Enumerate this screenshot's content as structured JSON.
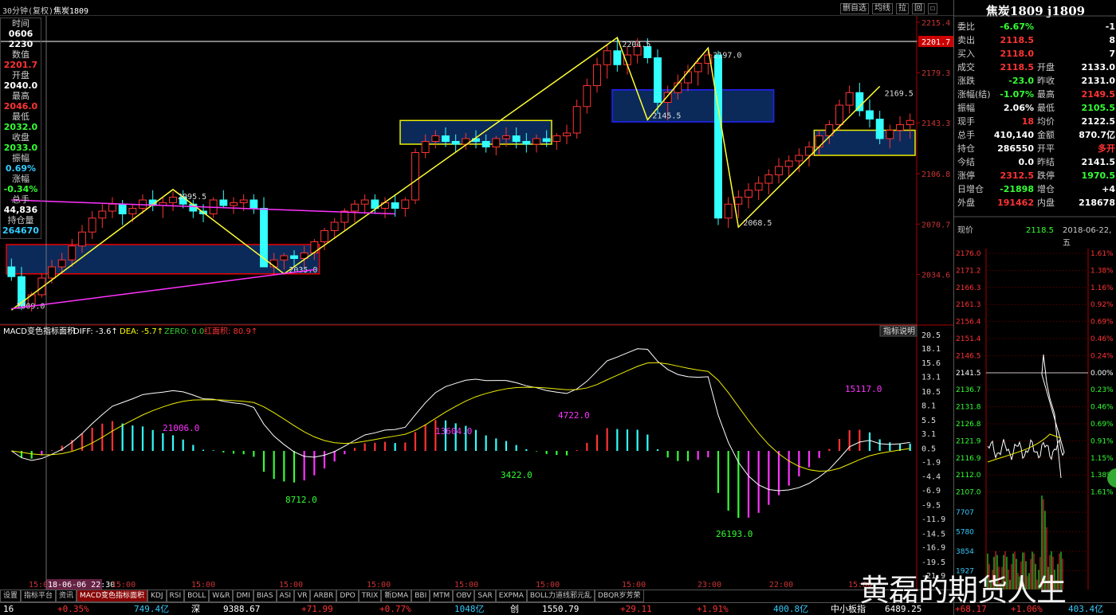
{
  "window": {
    "period": "30分钟(复权)",
    "symbol": "焦炭1809",
    "tools": [
      "删自选",
      "均线",
      "拉",
      "回",
      "☐"
    ]
  },
  "left_panel": [
    {
      "label": "时间",
      "value": "0606",
      "color": "#fff"
    },
    {
      "label": "",
      "value": "2230",
      "color": "#fff"
    },
    {
      "label": "数值",
      "value": "2201.7",
      "color": "#ff3333"
    },
    {
      "label": "开盘",
      "value": "2040.0",
      "color": "#fff"
    },
    {
      "label": "最高",
      "value": "2046.0",
      "color": "#ff3333"
    },
    {
      "label": "最低",
      "value": "2032.0",
      "color": "#33ff33"
    },
    {
      "label": "收盘",
      "value": "2033.0",
      "color": "#33ff33"
    },
    {
      "label": "振幅",
      "value": "0.69%",
      "color": "#33ccff"
    },
    {
      "label": "涨幅",
      "value": "-0.34%",
      "color": "#33ff33"
    },
    {
      "label": "总手",
      "value": "44,836",
      "color": "#fff"
    },
    {
      "label": "持仓量",
      "value": "264670",
      "color": "#33ccff"
    }
  ],
  "chart_data": {
    "type": "candlestick",
    "price_axis": [
      "2215.4",
      "2201.7",
      "2179.3",
      "2143.3",
      "2106.8",
      "2070.7",
      "2034.6"
    ],
    "current_price_label": "2201.7",
    "ylim": [
      2000,
      2220
    ],
    "candles": [
      [
        2040,
        2046,
        2030,
        2033
      ],
      [
        2033,
        2040,
        2009,
        2012
      ],
      [
        2012,
        2022,
        2008,
        2020
      ],
      [
        2020,
        2035,
        2018,
        2032
      ],
      [
        2032,
        2045,
        2028,
        2040
      ],
      [
        2040,
        2050,
        2035,
        2045
      ],
      [
        2045,
        2060,
        2040,
        2055
      ],
      [
        2055,
        2070,
        2050,
        2065
      ],
      [
        2065,
        2080,
        2060,
        2075
      ],
      [
        2075,
        2085,
        2068,
        2080
      ],
      [
        2080,
        2090,
        2075,
        2085
      ],
      [
        2085,
        2088,
        2070,
        2078
      ],
      [
        2078,
        2085,
        2072,
        2082
      ],
      [
        2082,
        2092,
        2078,
        2088
      ],
      [
        2088,
        2095,
        2080,
        2084
      ],
      [
        2084,
        2090,
        2075,
        2086
      ],
      [
        2086,
        2094,
        2080,
        2090
      ],
      [
        2090,
        2095,
        2082,
        2085
      ],
      [
        2085,
        2088,
        2075,
        2080
      ],
      [
        2080,
        2085,
        2072,
        2078
      ],
      [
        2078,
        2090,
        2075,
        2088
      ],
      [
        2088,
        2095,
        2082,
        2084
      ],
      [
        2084,
        2090,
        2078,
        2086
      ],
      [
        2086,
        2092,
        2080,
        2088
      ],
      [
        2088,
        2092,
        2078,
        2082
      ],
      [
        2082,
        2090,
        2040,
        2040
      ],
      [
        2040,
        2050,
        2035,
        2045
      ],
      [
        2045,
        2050,
        2038,
        2048
      ],
      [
        2048,
        2052,
        2040,
        2046
      ],
      [
        2046,
        2055,
        2040,
        2050
      ],
      [
        2050,
        2060,
        2045,
        2058
      ],
      [
        2058,
        2068,
        2052,
        2066
      ],
      [
        2066,
        2075,
        2060,
        2072
      ],
      [
        2072,
        2082,
        2066,
        2080
      ],
      [
        2080,
        2088,
        2072,
        2085
      ],
      [
        2085,
        2092,
        2078,
        2088
      ],
      [
        2088,
        2092,
        2078,
        2082
      ],
      [
        2082,
        2090,
        2075,
        2086
      ],
      [
        2086,
        2092,
        2076,
        2082
      ],
      [
        2082,
        2090,
        2076,
        2088
      ],
      [
        2088,
        2125,
        2085,
        2122
      ],
      [
        2122,
        2135,
        2118,
        2130
      ],
      [
        2130,
        2138,
        2125,
        2134
      ],
      [
        2134,
        2140,
        2126,
        2130
      ],
      [
        2130,
        2135,
        2122,
        2128
      ],
      [
        2128,
        2136,
        2124,
        2132
      ],
      [
        2132,
        2138,
        2125,
        2130
      ],
      [
        2130,
        2135,
        2122,
        2126
      ],
      [
        2126,
        2134,
        2120,
        2132
      ],
      [
        2132,
        2140,
        2126,
        2134
      ],
      [
        2134,
        2140,
        2125,
        2130
      ],
      [
        2130,
        2136,
        2122,
        2128
      ],
      [
        2128,
        2135,
        2122,
        2132
      ],
      [
        2132,
        2138,
        2126,
        2130
      ],
      [
        2130,
        2136,
        2124,
        2134
      ],
      [
        2134,
        2142,
        2128,
        2136
      ],
      [
        2136,
        2160,
        2132,
        2155
      ],
      [
        2155,
        2175,
        2150,
        2170
      ],
      [
        2170,
        2190,
        2165,
        2185
      ],
      [
        2185,
        2200,
        2175,
        2195
      ],
      [
        2195,
        2205,
        2180,
        2185
      ],
      [
        2185,
        2198,
        2178,
        2192
      ],
      [
        2192,
        2204,
        2186,
        2198
      ],
      [
        2198,
        2204,
        2186,
        2190
      ],
      [
        2190,
        2196,
        2150,
        2158
      ],
      [
        2158,
        2170,
        2145,
        2165
      ],
      [
        2165,
        2178,
        2160,
        2172
      ],
      [
        2172,
        2185,
        2166,
        2180
      ],
      [
        2180,
        2190,
        2170,
        2186
      ],
      [
        2186,
        2197,
        2178,
        2192
      ],
      [
        2192,
        2195,
        2070,
        2075
      ],
      [
        2075,
        2090,
        2068,
        2085
      ],
      [
        2085,
        2095,
        2075,
        2090
      ],
      [
        2090,
        2100,
        2082,
        2095
      ],
      [
        2095,
        2105,
        2088,
        2100
      ],
      [
        2100,
        2110,
        2092,
        2106
      ],
      [
        2106,
        2118,
        2100,
        2112
      ],
      [
        2112,
        2120,
        2104,
        2116
      ],
      [
        2116,
        2125,
        2108,
        2120
      ],
      [
        2120,
        2130,
        2112,
        2126
      ],
      [
        2126,
        2138,
        2120,
        2134
      ],
      [
        2134,
        2145,
        2128,
        2142
      ],
      [
        2142,
        2160,
        2138,
        2156
      ],
      [
        2156,
        2170,
        2150,
        2165
      ],
      [
        2165,
        2172,
        2148,
        2152
      ],
      [
        2152,
        2160,
        2140,
        2146
      ],
      [
        2146,
        2152,
        2128,
        2132
      ],
      [
        2132,
        2142,
        2125,
        2138
      ],
      [
        2138,
        2148,
        2130,
        2142
      ],
      [
        2142,
        2150,
        2132,
        2145
      ]
    ],
    "annotations": [
      "2009.0",
      "2095.5",
      "2035.0",
      "2204.5",
      "2145.5",
      "2197.0",
      "2068.5",
      "2169.5"
    ],
    "macd": {
      "title": "MACD变色指标面积",
      "diff": "DIFF: -3.6↑",
      "dea": "DEA: -5.7↑",
      "zero": "ZERO: 0.0",
      "red_area": "红面积: 80.9↑",
      "axis": [
        "20.5",
        "18.1",
        "15.6",
        "13.1",
        "10.5",
        "8.1",
        "5.5",
        "3.1",
        "0.5",
        "-1.9",
        "-4.4",
        "-6.9",
        "-9.5",
        "-11.9",
        "-14.5",
        "-16.9",
        "-19.5",
        "-21.9"
      ],
      "area_labels": [
        "21006.0",
        "8712.0",
        "13604.0",
        "3422.0",
        "4722.0",
        "26193.0",
        "15117.0"
      ],
      "help": "指标说明"
    },
    "time_axis": [
      "15:00",
      "18-06-06 22:30",
      "15:00",
      "15:00",
      "15:00",
      "15:00",
      "15:00",
      "15:00",
      "15:00",
      "23:00",
      "22:00",
      "15:00"
    ]
  },
  "right_panel": {
    "title": "焦炭1809 j1809",
    "rows": [
      {
        "a": "委比",
        "b": "-6.67%",
        "c": "",
        "d": "-1"
      },
      {
        "a": "卖出",
        "b": "2118.5",
        "c": "",
        "d": "8"
      },
      {
        "a": "买入",
        "b": "2118.0",
        "c": "",
        "d": "7"
      },
      {
        "a": "成交",
        "b": "2118.5",
        "c": "开盘",
        "d": "2133.0"
      },
      {
        "a": "涨跌",
        "b": "-23.0",
        "c": "昨收",
        "d": "2131.0"
      },
      {
        "a": "涨幅(结)",
        "b": "-1.07%",
        "c": "最高",
        "d": "2149.5"
      },
      {
        "a": "振幅",
        "b": "2.06%",
        "c": "最低",
        "d": "2105.5"
      },
      {
        "a": "现手",
        "b": "18",
        "c": "均价",
        "d": "2122.5"
      },
      {
        "a": "总手",
        "b": "410,140",
        "c": "金额",
        "d": "870.7亿"
      },
      {
        "a": "持仓",
        "b": "286550",
        "c": "开平",
        "d": "多开"
      },
      {
        "a": "今结",
        "b": "0.0",
        "c": "昨结",
        "d": "2141.5"
      },
      {
        "a": "涨停",
        "b": "2312.5",
        "c": "跌停",
        "d": "1970.5"
      },
      {
        "a": "日增仓",
        "b": "-21898",
        "c": "增仓",
        "d": "+4"
      },
      {
        "a": "外盘",
        "b": "191462",
        "c": "内盘",
        "d": "218678"
      }
    ],
    "now_label": "现价",
    "now_price": "2118.5",
    "date": "2018-06-22,五",
    "mini_left": [
      "2176.0",
      "2171.2",
      "2166.3",
      "2161.3",
      "2156.4",
      "2151.4",
      "2146.5",
      "2141.5",
      "2136.7",
      "2131.8",
      "2126.8",
      "2121.9",
      "2116.9",
      "2112.0",
      "2107.0",
      "7707",
      "5780",
      "3854",
      "1927"
    ],
    "mini_right": [
      "1.61%",
      "1.38%",
      "1.16%",
      "0.92%",
      "0.69%",
      "0.46%",
      "0.24%",
      "0.00%",
      "0.23%",
      "0.46%",
      "0.69%",
      "0.91%",
      "1.15%",
      "1.38%",
      "1.61%"
    ]
  },
  "tabs": [
    "设置",
    "指标平台",
    "资讯",
    "MACD变色指标面积",
    "KDJ",
    "RSI",
    "BOLL",
    "W&R",
    "DMI",
    "BIAS",
    "ASI",
    "VR",
    "ARBR",
    "DPO",
    "TRIX",
    "新DMA",
    "BBI",
    "MTM",
    "OBV",
    "SAR",
    "EXPMA",
    "BOLL力道线邪元乱",
    "DBQR岁芳荣"
  ],
  "status": [
    {
      "t": "16",
      "x": 4,
      "c": "#fff"
    },
    {
      "t": "+0.35%",
      "x": 72,
      "c": "#ff3333"
    },
    {
      "t": "749.4亿",
      "x": 168,
      "c": "#33ccff"
    },
    {
      "t": "深",
      "x": 240,
      "c": "#fff"
    },
    {
      "t": "9388.67",
      "x": 280,
      "c": "#fff"
    },
    {
      "t": "+71.99",
      "x": 378,
      "c": "#ff3333"
    },
    {
      "t": "+0.77%",
      "x": 476,
      "c": "#ff3333"
    },
    {
      "t": "1048亿",
      "x": 570,
      "c": "#33ccff"
    },
    {
      "t": "创",
      "x": 640,
      "c": "#fff"
    },
    {
      "t": "1550.79",
      "x": 680,
      "c": "#fff"
    },
    {
      "t": "+29.11",
      "x": 778,
      "c": "#ff3333"
    },
    {
      "t": "+1.91%",
      "x": 874,
      "c": "#ff3333"
    },
    {
      "t": "400.8亿",
      "x": 970,
      "c": "#33ccff"
    },
    {
      "t": "中小板指",
      "x": 1042,
      "c": "#fff"
    },
    {
      "t": "6489.25",
      "x": 1110,
      "c": "#fff"
    },
    {
      "t": "+68.17",
      "x": 1198,
      "c": "#ff3333"
    },
    {
      "t": "+1.06%",
      "x": 1268,
      "c": "#ff3333"
    },
    {
      "t": "403.4亿",
      "x": 1340,
      "c": "#33ccff"
    }
  ],
  "watermark": "黄磊的期货人生"
}
